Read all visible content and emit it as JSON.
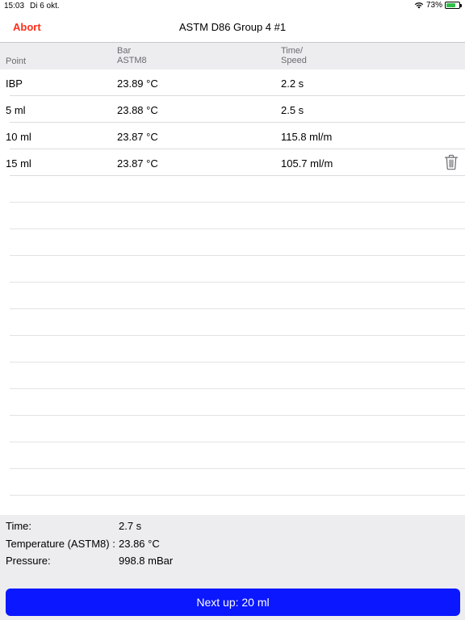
{
  "status_bar": {
    "time": "15:03",
    "date": "Di 6 okt.",
    "battery": "73%",
    "battery_level": 0.73
  },
  "nav": {
    "abort_label": "Abort",
    "title": "ASTM D86 Group 4 #1"
  },
  "table": {
    "headers": {
      "point": "Point",
      "bar_top": "Bar",
      "bar_bottom": "ASTM8",
      "time_top": "Time/",
      "time_bottom": "Speed"
    },
    "rows": [
      {
        "point": "IBP",
        "temp": "23.89 °C",
        "time": "2.2 s"
      },
      {
        "point": "5 ml",
        "temp": "23.88 °C",
        "time": "2.5 s"
      },
      {
        "point": "10 ml",
        "temp": "23.87 °C",
        "time": "115.8 ml/m"
      },
      {
        "point": "15 ml",
        "temp": "23.87 °C",
        "time": "105.7 ml/m"
      }
    ]
  },
  "info": {
    "time_label": "Time:",
    "time_value": "2.7 s",
    "temp_label": "Temperature (ASTM8) :",
    "temp_value": "23.86 °C",
    "pressure_label": "Pressure:",
    "pressure_value": "998.8 mBar"
  },
  "next_button": {
    "label": "Next up: 20 ml"
  },
  "colors": {
    "accent_red": "#ff2d1a",
    "button_blue": "#0a17ff",
    "panel_gray": "#ededf0"
  }
}
